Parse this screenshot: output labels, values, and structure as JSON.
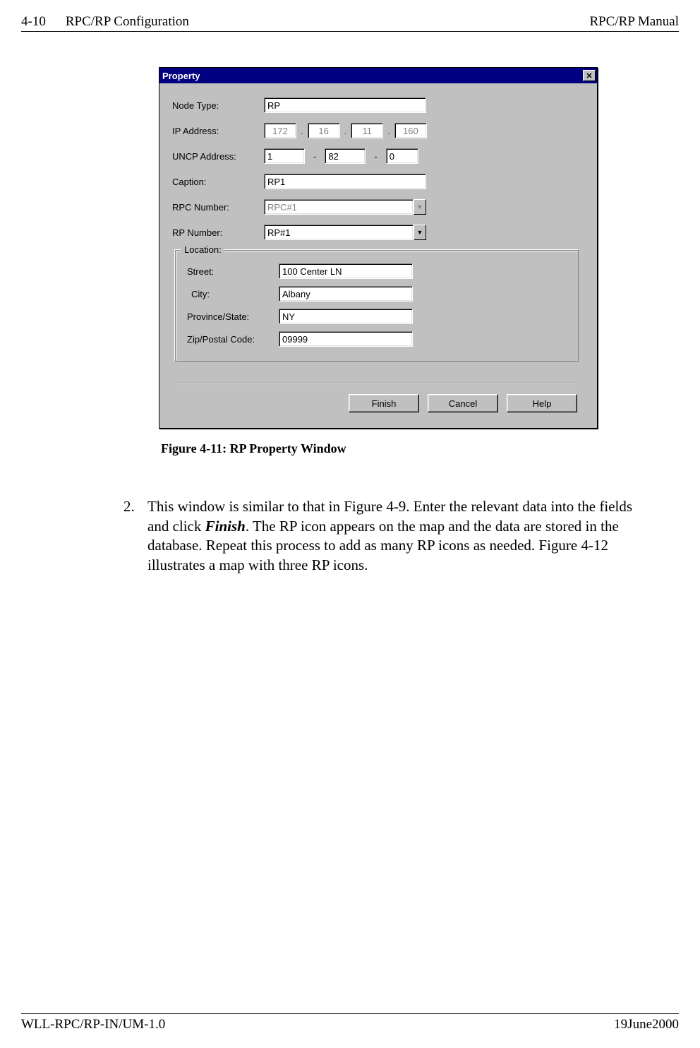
{
  "header": {
    "page_num": "4-10",
    "section": "RPC/RP Configuration",
    "manual": "RPC/RP Manual"
  },
  "dialog": {
    "title": "Property",
    "labels": {
      "node_type": "Node Type:",
      "ip_address": "IP Address:",
      "uncp_address": "UNCP Address:",
      "caption": "Caption:",
      "rpc_number": "RPC Number:",
      "rp_number": "RP Number:"
    },
    "values": {
      "node_type": "RP",
      "ip": [
        "172",
        "16",
        "11",
        "160"
      ],
      "uncp": [
        "1",
        "82",
        "0"
      ],
      "caption": "RP1",
      "rpc_number": "RPC#1",
      "rp_number": "RP#1"
    },
    "location": {
      "group_label": "Location:",
      "labels": {
        "street": "Street:",
        "city": "City:",
        "province": "Province/State:",
        "zip": "Zip/Postal Code:"
      },
      "values": {
        "street": "100 Center LN",
        "city": "Albany",
        "province": "NY",
        "zip": "09999"
      }
    },
    "buttons": {
      "finish": "Finish",
      "cancel": "Cancel",
      "help": "Help"
    }
  },
  "figure_caption": "Figure 4-11: RP Property Window",
  "body": {
    "num": "2.",
    "p1a": "This window is similar to that in Figure 4-9.  Enter the relevant data into the fields and click ",
    "finish_word": "Finish",
    "p1b": ".  The RP icon appears on the map and the data are stored in the database.  Repeat this process to add as many RP icons as needed.  Figure 4-12 illustrates a map with three RP icons."
  },
  "footer": {
    "left": "WLL-RPC/RP-IN/UM-1.0",
    "right": "19June2000"
  }
}
